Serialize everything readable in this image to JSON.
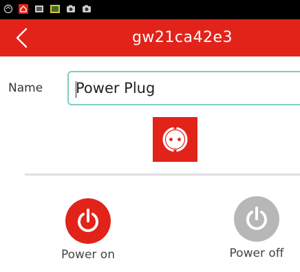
{
  "status_bar": {
    "icons": [
      "sync-icon",
      "home-app-icon",
      "screen-icon",
      "image-icon",
      "camera-icon",
      "camera-alt-icon"
    ]
  },
  "header": {
    "title": "gw21ca42e3",
    "back_icon": "chevron-left-icon"
  },
  "form": {
    "name_label": "Name",
    "name_value": "Power Plug"
  },
  "device": {
    "icon": "power-socket-icon"
  },
  "controls": {
    "power_on_label": "Power on",
    "power_off_label": "Power off"
  },
  "colors": {
    "accent": "#e2231a",
    "input_border": "#7ccfbf",
    "inactive": "#b7b7b7"
  }
}
